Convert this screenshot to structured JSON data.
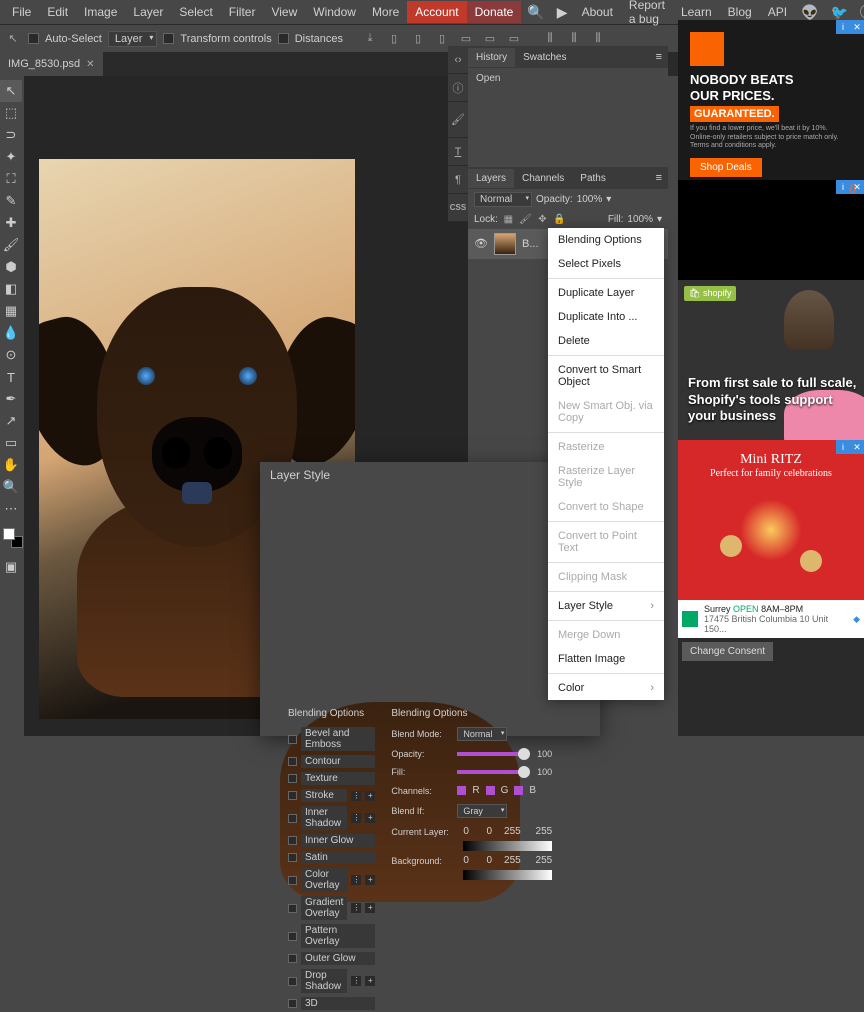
{
  "menu": {
    "file": "File",
    "edit": "Edit",
    "image": "Image",
    "layer": "Layer",
    "select": "Select",
    "filter": "Filter",
    "view": "View",
    "window": "Window",
    "more": "More",
    "account": "Account",
    "donate": "Donate",
    "about": "About",
    "report": "Report a bug",
    "learn": "Learn",
    "blog": "Blog",
    "api": "API"
  },
  "opt": {
    "autosel": "Auto-Select",
    "layer": "Layer",
    "transform": "Transform controls",
    "dist": "Distances"
  },
  "file": {
    "name": "IMG_8530.psd"
  },
  "hist": {
    "tab1": "History",
    "tab2": "Swatches",
    "item": "Open"
  },
  "layerspanel": {
    "tab1": "Layers",
    "tab2": "Channels",
    "tab3": "Paths",
    "mode": "Normal",
    "oplab": "Opacity:",
    "opval": "100%",
    "lock": "Lock:",
    "filllab": "Fill:",
    "fillval": "100%",
    "layer": "B..."
  },
  "ctx": {
    "bo": "Blending Options",
    "sp": "Select Pixels",
    "dl": "Duplicate Layer",
    "di": "Duplicate Into ...",
    "del": "Delete",
    "cso": "Convert to Smart Object",
    "nso": "New Smart Obj. via Copy",
    "ras": "Rasterize",
    "rls": "Rasterize Layer Style",
    "cts": "Convert to Shape",
    "cpt": "Convert to Point Text",
    "cm": "Clipping Mask",
    "ls": "Layer Style",
    "md": "Merge Down",
    "fi": "Flatten Image",
    "col": "Color"
  },
  "ls": {
    "title": "Layer Style",
    "h": "Blending Options",
    "items": [
      "Bevel and Emboss",
      "Contour",
      "Texture",
      "Stroke",
      "Inner Shadow",
      "Inner Glow",
      "Satin",
      "Color Overlay",
      "Gradient Overlay",
      "Pattern Overlay",
      "Outer Glow",
      "Drop Shadow",
      "3D"
    ],
    "bm": "Blend Mode:",
    "bmval": "Normal",
    "op": "Opacity:",
    "opv": "100",
    "fill": "Fill:",
    "fillv": "100",
    "ch": "Channels:",
    "r": "R",
    "g": "G",
    "b": "B",
    "bi": "Blend If:",
    "bival": "Gray",
    "cl": "Current Layer:",
    "cl0": "0",
    "cl1": "0",
    "cl2": "255",
    "cl3": "255",
    "bg": "Background:",
    "bg0": "0",
    "bg1": "0",
    "bg2": "255",
    "bg3": "255"
  },
  "ads": {
    "hd": {
      "h1": "NOBODY BEATS",
      "h2": "OUR PRICES.",
      "g": "GUARANTEED.",
      "s": "If you find a lower price, we'll beat it by 10%. Online-only retailers subject to price match only.",
      "s2": "Terms and conditions apply.",
      "btn": "Shop Deals"
    },
    "sh": {
      "tag": "shopify",
      "tx": "From first sale to full scale, Shopify's tools support your business"
    },
    "ritz": {
      "h": "Mini RITZ",
      "s": "Perfect for family celebrations"
    },
    "store": {
      "name": "Surrey",
      "open": "OPEN",
      "hrs": "8AM–8PM",
      "addr": "17475 British Columbia 10 Unit 150..."
    },
    "consent": "Change Consent"
  }
}
